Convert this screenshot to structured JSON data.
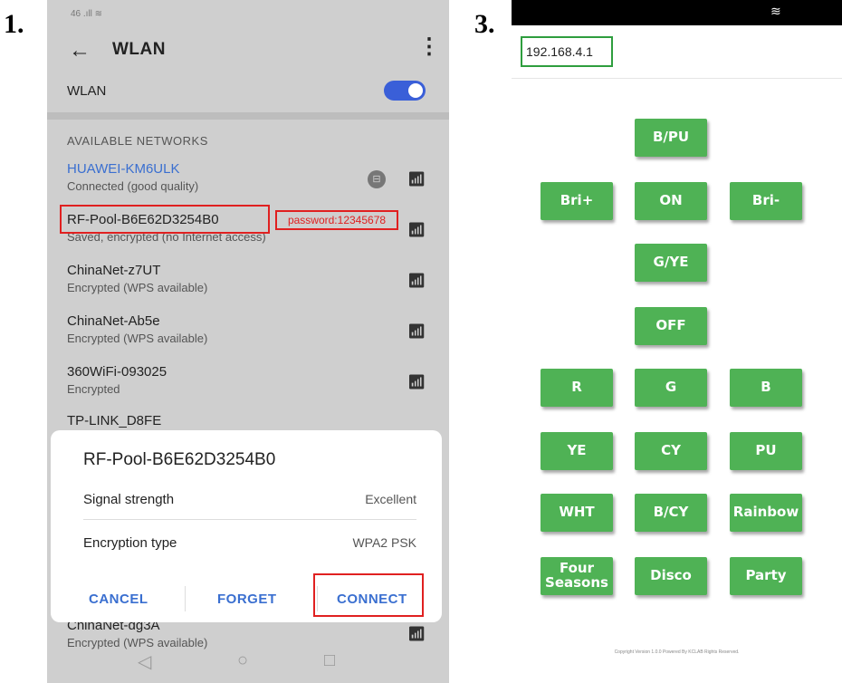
{
  "step_labels": {
    "left": "1.",
    "right": "3."
  },
  "left_phone": {
    "status_bar": "46 .ıll ≋",
    "header": {
      "back_icon": "←",
      "title": "WLAN",
      "more_icon": "⋮"
    },
    "wlan_toggle": {
      "label": "WLAN",
      "state": "on",
      "color": "#3a5fd8"
    },
    "section_header": "AVAILABLE NETWORKS",
    "networks": [
      {
        "name": "HUAWEI-KM6ULK",
        "status": "Connected (good quality)"
      },
      {
        "name": "RF-Pool-B6E62D3254B0",
        "status": "Saved, encrypted (no Internet access)"
      },
      {
        "name": "ChinaNet-z7UT",
        "status": "Encrypted (WPS available)"
      },
      {
        "name": "ChinaNet-Ab5e",
        "status": "Encrypted (WPS available)"
      },
      {
        "name": "360WiFi-093025",
        "status": "Encrypted"
      },
      {
        "name": "TP-LINK_D8FE",
        "status": ""
      },
      {
        "name": "ChinaNet-dg3A",
        "status": "Encrypted (WPS available)"
      }
    ],
    "password_note": "password:12345678",
    "annotation_color": "#e02020",
    "dialog": {
      "title": "RF-Pool-B6E62D3254B0",
      "rows": [
        {
          "label": "Signal strength",
          "value": "Excellent"
        },
        {
          "label": "Encryption type",
          "value": "WPA2 PSK"
        }
      ],
      "buttons": {
        "cancel": "CANCEL",
        "forget": "FORGET",
        "connect": "CONNECT"
      }
    },
    "nav_icons": {
      "back": "◁",
      "home": "○",
      "recents": "□"
    }
  },
  "right_phone": {
    "url": "192.168.4.1",
    "button_color": "#4fb255",
    "buttons": {
      "b_pu": "B/PU",
      "bri_plus": "Bri+",
      "on": "ON",
      "bri_minus": "Bri-",
      "g_ye": "G/YE",
      "off": "OFF",
      "r": "R",
      "g": "G",
      "b": "B",
      "ye": "YE",
      "cy": "CY",
      "pu": "PU",
      "wht": "WHT",
      "b_cy": "B/CY",
      "rainbow": "Rainbow",
      "four_seasons": "Four Seasons",
      "disco": "Disco",
      "party": "Party"
    },
    "copyright": "Copyright Version 1.0.0 Powered By KCLAB Rights Reserved."
  }
}
